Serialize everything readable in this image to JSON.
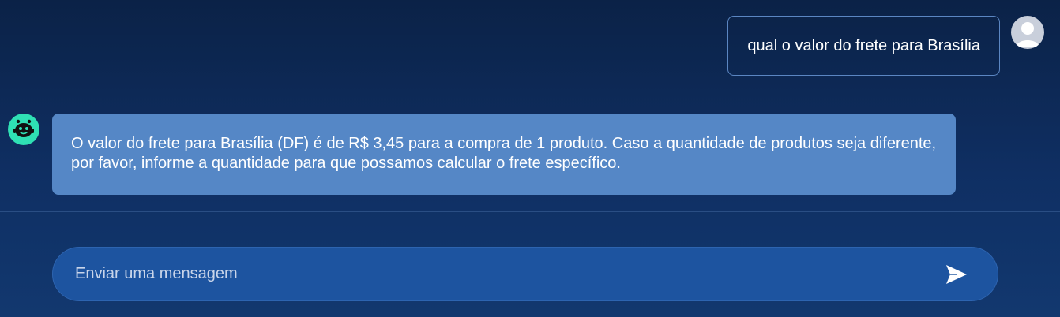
{
  "conversation": {
    "user_message": "qual o valor do frete para Brasília",
    "bot_message": "O valor do frete para Brasília (DF) é de R$ 3,45 para a compra de 1 produto. Caso a quantidade de produtos seja diferente, por favor, informe a quantidade para que possamos calcular o frete específico."
  },
  "composer": {
    "placeholder": "Enviar uma mensagem",
    "value": ""
  },
  "icons": {
    "user_avatar": "user-avatar-icon",
    "bot_avatar": "robot-icon",
    "send": "send-icon"
  },
  "colors": {
    "background": "#0b2247",
    "bot_bubble": "#5587c6",
    "user_bubble_border": "#5b86c2",
    "input_bg": "#1d54a0",
    "bot_avatar_bg": "#2fe0b4"
  }
}
